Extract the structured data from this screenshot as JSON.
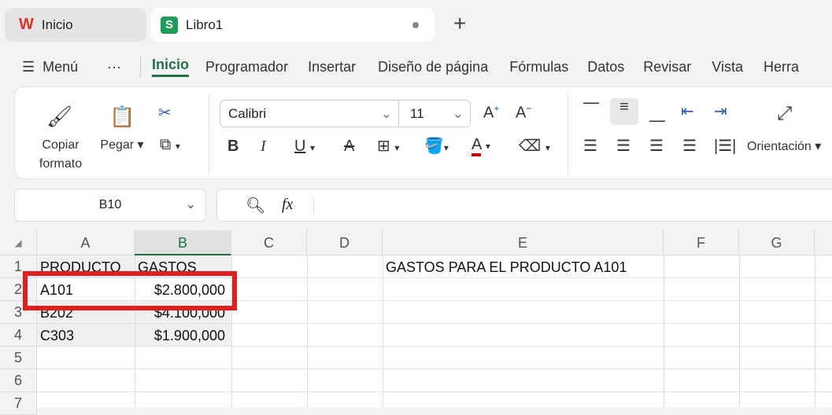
{
  "tabs": [
    {
      "label": "Inicio",
      "icon": "wps-logo-icon"
    },
    {
      "label": "Libro1",
      "icon": "sheets-icon",
      "icon_letter": "S"
    }
  ],
  "menu": {
    "menu_label": "Menú",
    "more": "···",
    "items": [
      "Inicio",
      "Programador",
      "Insertar",
      "Diseño de página",
      "Fórmulas",
      "Datos",
      "Revisar",
      "Vista",
      "Herra"
    ],
    "active": "Inicio"
  },
  "ribbon": {
    "copy_format_1": "Copiar",
    "copy_format_2": "formato",
    "paste": "Pegar",
    "font": "Calibri",
    "size": "11",
    "bold": "B",
    "italic": "I",
    "underline": "U",
    "orientation": "Orientación"
  },
  "formula_bar": {
    "name_box": "B10",
    "fx": "fx",
    "value": ""
  },
  "columns": [
    "A",
    "B",
    "C",
    "D",
    "E",
    "F",
    "G"
  ],
  "rows": [
    "1",
    "2",
    "3",
    "4",
    "5",
    "6",
    "7"
  ],
  "cells": {
    "A1": "PRODUCTO",
    "B1": "GASTOS",
    "A2": "A101",
    "B2": "$2.800,000",
    "A3": "B202",
    "B3": "$4.100,000",
    "A4": "C303",
    "B4": "$1.900,000",
    "E1": "GASTOS PARA EL PRODUCTO A101"
  },
  "colors": {
    "accent": "#1e7145",
    "highlight": "#e02020",
    "font_color": "#d40000"
  }
}
